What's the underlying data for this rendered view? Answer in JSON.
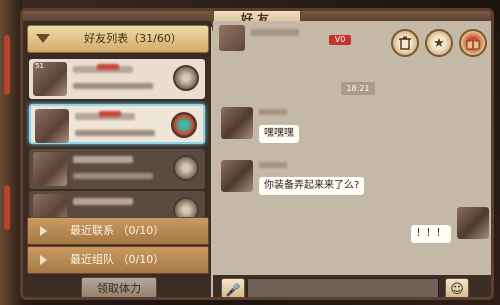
{
  "window": {
    "title": "好友",
    "close_icon": "close-icon"
  },
  "friend_list": {
    "header": "好友列表（31/60）",
    "friends": [
      {
        "level": "51"
      },
      {
        "level": ""
      },
      {
        "level": ""
      },
      {
        "level": ""
      }
    ],
    "sections": [
      {
        "label": "最近联系 （0/10）"
      },
      {
        "label": "最近组队 （0/10）"
      }
    ],
    "claim_button": "领取体力"
  },
  "chat": {
    "badge": "V0",
    "icons": [
      "trash-icon",
      "star-icon",
      "gift-icon"
    ],
    "timestamp": "18:21",
    "messages": [
      {
        "side": "left",
        "text": "嘿嘿嘿"
      },
      {
        "side": "left",
        "text": "你装备弄起来来了么?"
      },
      {
        "side": "right",
        "text": "！！！"
      }
    ],
    "input_placeholder": ""
  },
  "colors": {
    "accent": "#d2ad6b",
    "selected_border": "#8ad6ea",
    "badge": "#c7322c"
  }
}
